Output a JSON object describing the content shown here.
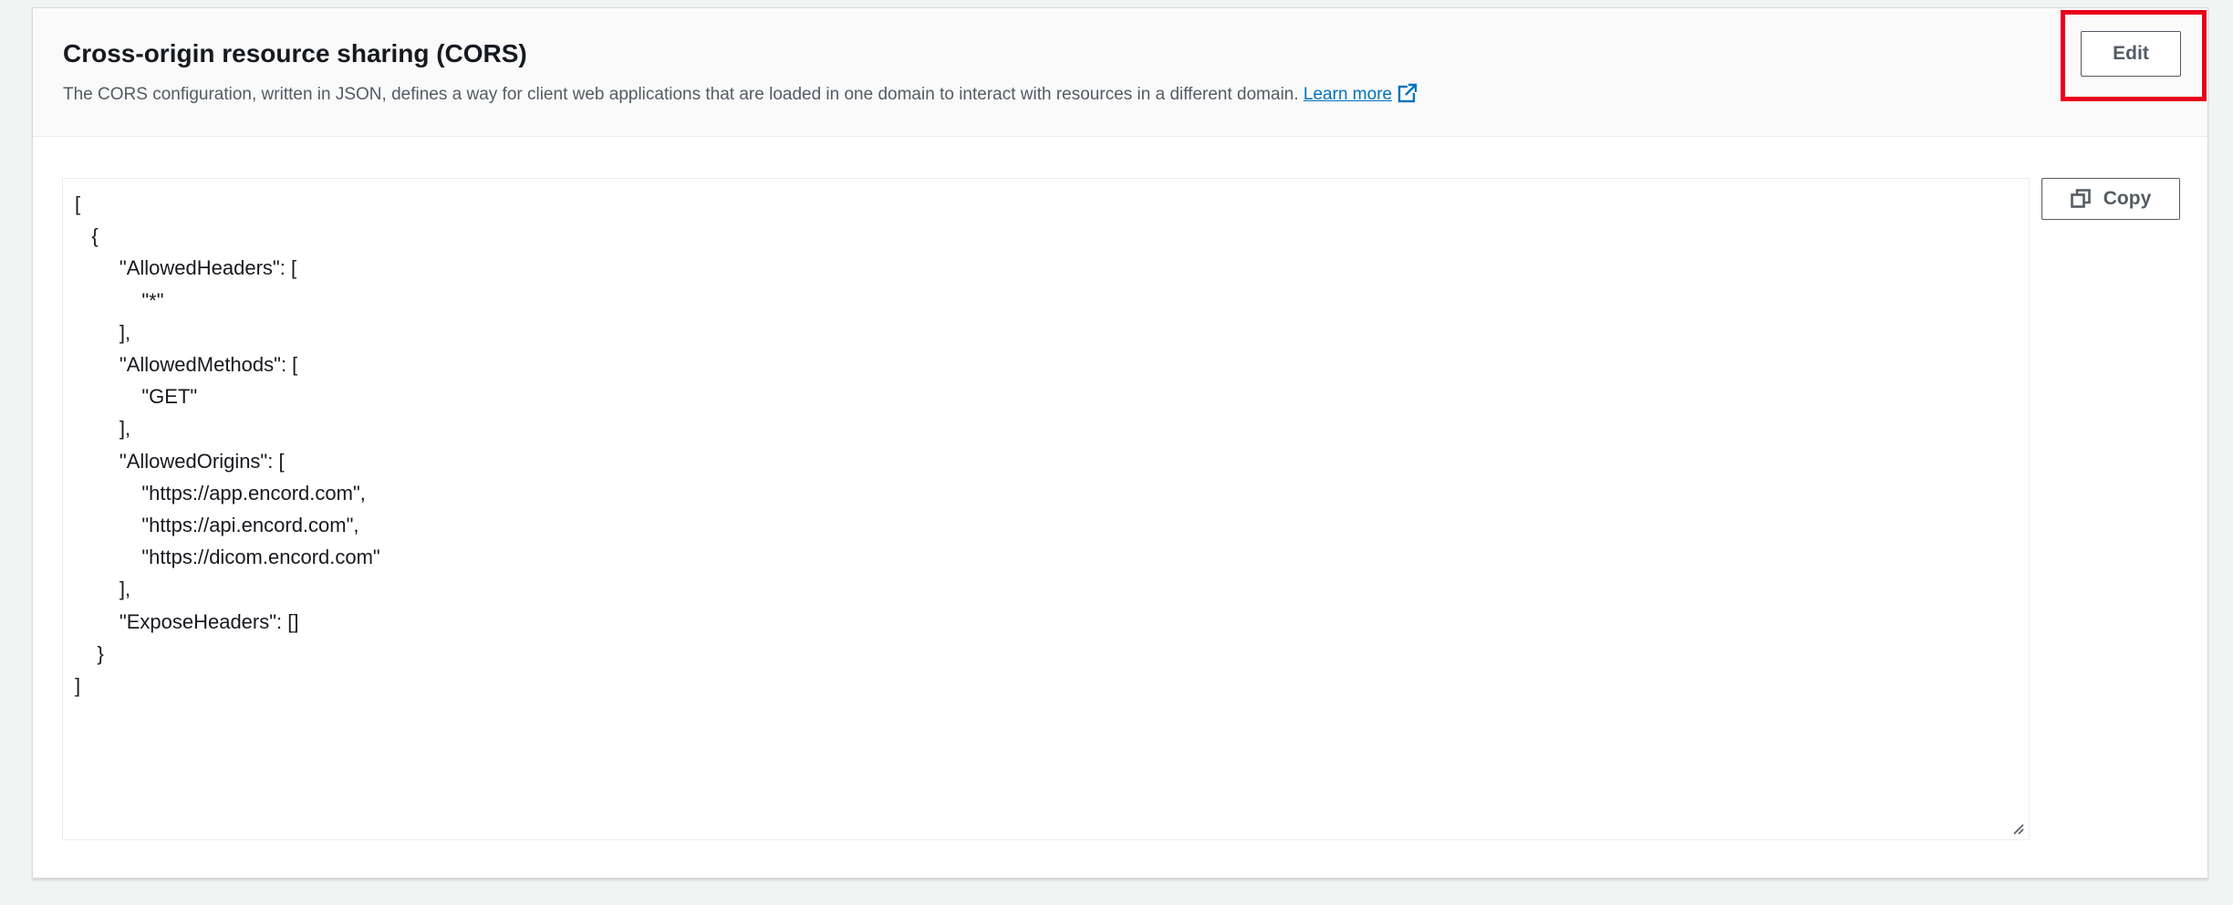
{
  "panel": {
    "title": "Cross-origin resource sharing (CORS)",
    "description": "The CORS configuration, written in JSON, defines a way for client web applications that are loaded in one domain to interact with resources in a different domain.",
    "learn_more_label": "Learn more",
    "edit_label": "Edit"
  },
  "editor": {
    "copy_label": "Copy",
    "content": "[\n   {\n        \"AllowedHeaders\": [\n            \"*\"\n        ],\n        \"AllowedMethods\": [\n            \"GET\"\n        ],\n        \"AllowedOrigins\": [\n            \"https://app.encord.com\",\n            \"https://api.encord.com\",\n            \"https://dicom.encord.com\"\n        ],\n        \"ExposeHeaders\": []\n    }\n]"
  },
  "icons": {
    "external_link": "external-link-icon",
    "copy": "copy-icon",
    "resize": "resize-handle-icon"
  },
  "colors": {
    "link": "#0073bb",
    "highlight": "#e8001c",
    "button_border": "#545b64",
    "header_bg": "#fafafa",
    "page_bg": "#f2f3f3"
  }
}
